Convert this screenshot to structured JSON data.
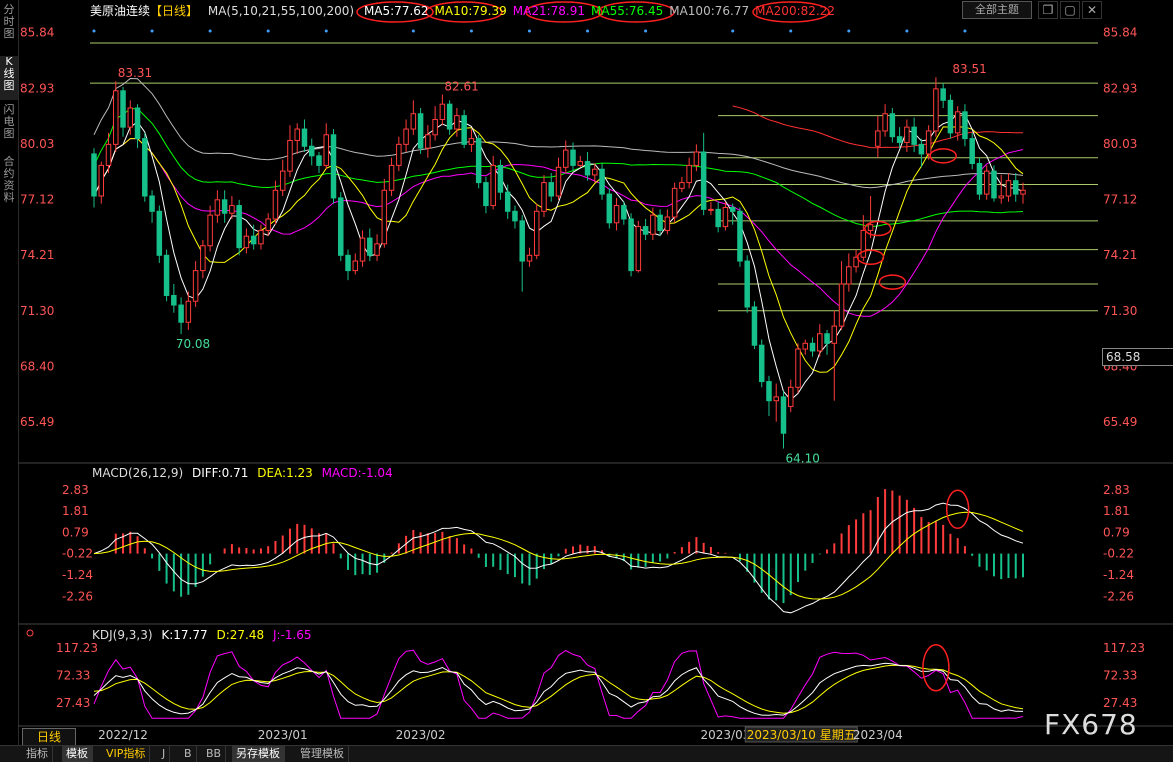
{
  "left_tabs": [
    "分时图",
    "K线图",
    "闪电图",
    "合约资料"
  ],
  "instrument": "美原油连续",
  "period_tag": "【日线】",
  "ma_header": {
    "label": "MA(5,10,21,55,100,200)",
    "items": [
      {
        "label": "MA5:77.62",
        "color": "#ffffff"
      },
      {
        "label": "MA10:79.39",
        "color": "#ffff00"
      },
      {
        "label": "MA21:78.91",
        "color": "#ff00ff"
      },
      {
        "label": "MA55:76.45",
        "color": "#00ff00"
      },
      {
        "label": "MA100:76.77",
        "color": "#bbbbbb"
      },
      {
        "label": "MA200:82.22",
        "color": "#ff3030"
      }
    ]
  },
  "top_right": {
    "theme": "全部主题",
    "icons": [
      "restore-icon",
      "minimize-icon",
      "close-icon"
    ]
  },
  "macd_header": {
    "title": "MACD(26,12,9)",
    "diff": "DIFF:0.71",
    "dea": "DEA:1.23",
    "macd": "MACD:-1.04"
  },
  "kdj_header": {
    "title": "KDJ(9,3,3)",
    "k": "K:17.77",
    "d": "D:27.48",
    "j": "J:-1.65"
  },
  "last_price": "68.58",
  "period_button": "日线",
  "bottom_tabs": [
    "指标",
    "模板",
    "VIP指标",
    "J",
    "B",
    "BB",
    "另存模板",
    "管理模板"
  ],
  "watermark": "FX678",
  "colors": {
    "up": "#ff3b3b",
    "down": "#16c08a",
    "axis": "#ff5555",
    "ma5": "#ffffff",
    "ma10": "#ffff00",
    "ma21": "#ff00ff",
    "ma55": "#00ff00",
    "ma100": "#bbbbbb",
    "ma200": "#ff3030"
  },
  "chart_data": {
    "type": "candlestick",
    "main": {
      "y_ticks": [
        "85.84",
        "82.93",
        "80.03",
        "77.12",
        "74.21",
        "71.30",
        "68.40",
        "65.49"
      ],
      "ylim": [
        63.5,
        86.5
      ],
      "annotations": [
        {
          "text": "83.31",
          "type": "high",
          "bar": 3,
          "value": 83.31
        },
        {
          "text": "82.61",
          "type": "high",
          "bar": 48,
          "value": 82.61
        },
        {
          "text": "70.08",
          "type": "low",
          "bar": 11,
          "value": 70.08
        },
        {
          "text": "64.10",
          "type": "low",
          "bar": 95,
          "value": 64.1
        },
        {
          "text": "83.51",
          "type": "high",
          "bar": 118,
          "value": 83.51
        }
      ],
      "horizontal_levels": [
        85.3,
        83.2,
        81.5,
        79.3,
        77.9,
        76.0,
        74.5,
        72.7,
        71.3
      ],
      "candles": [
        [
          79.5,
          77.3,
          79.8,
          76.7
        ],
        [
          77.3,
          78.9,
          79.1,
          76.9
        ],
        [
          78.9,
          80.0,
          80.6,
          78.5
        ],
        [
          80.0,
          82.8,
          83.3,
          79.6
        ],
        [
          82.8,
          80.9,
          83.0,
          80.4
        ],
        [
          80.9,
          81.9,
          82.3,
          80.5
        ],
        [
          81.9,
          80.3,
          82.1,
          79.8
        ],
        [
          80.3,
          77.3,
          80.6,
          77.0
        ],
        [
          77.3,
          76.5,
          77.6,
          75.9
        ],
        [
          76.5,
          74.2,
          76.8,
          73.8
        ],
        [
          74.2,
          72.1,
          74.5,
          71.8
        ],
        [
          72.1,
          71.6,
          72.7,
          71.2
        ],
        [
          71.6,
          70.7,
          72.0,
          70.08
        ],
        [
          70.7,
          71.8,
          72.3,
          70.3
        ],
        [
          71.8,
          73.4,
          73.9,
          71.5
        ],
        [
          73.4,
          74.7,
          75.0,
          73.0
        ],
        [
          74.7,
          76.3,
          76.8,
          74.4
        ],
        [
          76.3,
          77.1,
          77.6,
          75.9
        ],
        [
          77.1,
          76.4,
          77.6,
          75.9
        ],
        [
          76.4,
          76.8,
          77.3,
          76.1
        ],
        [
          76.8,
          74.6,
          77.1,
          74.2
        ],
        [
          74.6,
          75.2,
          75.6,
          74.3
        ],
        [
          75.2,
          74.8,
          75.8,
          74.5
        ],
        [
          74.8,
          75.5,
          75.8,
          74.5
        ],
        [
          75.5,
          76.1,
          76.4,
          75.2
        ],
        [
          76.1,
          77.6,
          78.1,
          75.8
        ],
        [
          77.6,
          78.6,
          79.2,
          77.3
        ],
        [
          78.6,
          80.2,
          81.0,
          78.3
        ],
        [
          80.2,
          80.8,
          81.1,
          79.5
        ],
        [
          80.8,
          79.9,
          81.3,
          79.6
        ],
        [
          79.9,
          79.4,
          80.3,
          78.9
        ],
        [
          79.4,
          78.9,
          79.6,
          78.5
        ],
        [
          78.9,
          80.5,
          81.1,
          78.7
        ],
        [
          80.5,
          77.2,
          80.8,
          76.9
        ],
        [
          77.2,
          74.2,
          77.5,
          73.9
        ],
        [
          74.2,
          73.4,
          74.5,
          72.9
        ],
        [
          73.4,
          73.9,
          74.3,
          73.2
        ],
        [
          73.9,
          75.1,
          75.5,
          73.6
        ],
        [
          75.1,
          74.2,
          75.6,
          73.9
        ],
        [
          74.2,
          74.8,
          75.3,
          73.9
        ],
        [
          74.8,
          77.6,
          78.2,
          74.6
        ],
        [
          77.6,
          78.9,
          79.3,
          77.3
        ],
        [
          78.9,
          80.0,
          80.4,
          78.6
        ],
        [
          80.0,
          80.8,
          81.3,
          79.6
        ],
        [
          80.8,
          81.6,
          82.3,
          80.5
        ],
        [
          81.6,
          79.8,
          81.9,
          79.5
        ],
        [
          79.8,
          80.5,
          81.0,
          79.3
        ],
        [
          80.5,
          81.3,
          82.0,
          80.2
        ],
        [
          81.3,
          82.1,
          82.61,
          81.0
        ],
        [
          82.1,
          80.8,
          82.3,
          80.5
        ],
        [
          80.8,
          81.5,
          81.9,
          80.4
        ],
        [
          81.5,
          80.0,
          81.8,
          79.8
        ],
        [
          80.0,
          80.3,
          80.8,
          79.6
        ],
        [
          80.3,
          78.0,
          80.5,
          77.7
        ],
        [
          78.0,
          76.8,
          78.3,
          76.4
        ],
        [
          76.8,
          78.9,
          79.4,
          76.6
        ],
        [
          78.9,
          77.5,
          79.2,
          77.1
        ],
        [
          77.5,
          76.5,
          77.9,
          76.1
        ],
        [
          76.5,
          76.0,
          76.8,
          75.6
        ],
        [
          76.0,
          73.9,
          76.3,
          72.3
        ],
        [
          73.9,
          74.2,
          74.6,
          73.6
        ],
        [
          74.2,
          76.5,
          76.9,
          74.0
        ],
        [
          76.5,
          78.0,
          78.4,
          76.2
        ],
        [
          78.0,
          77.3,
          78.5,
          77.0
        ],
        [
          77.3,
          78.8,
          79.3,
          77.1
        ],
        [
          78.8,
          79.7,
          80.2,
          78.5
        ],
        [
          79.7,
          78.9,
          80.1,
          78.6
        ],
        [
          78.9,
          79.1,
          79.4,
          78.8
        ],
        [
          79.1,
          78.4,
          79.6,
          78.1
        ],
        [
          78.4,
          78.7,
          79.0,
          78.0
        ],
        [
          78.7,
          77.4,
          79.0,
          77.1
        ],
        [
          77.4,
          75.9,
          77.7,
          75.6
        ],
        [
          75.9,
          76.8,
          77.2,
          75.5
        ],
        [
          76.8,
          76.1,
          77.0,
          75.8
        ],
        [
          76.1,
          73.4,
          76.4,
          73.1
        ],
        [
          73.4,
          75.7,
          76.0,
          73.3
        ],
        [
          75.7,
          75.3,
          76.1,
          75.0
        ],
        [
          75.3,
          76.3,
          76.7,
          75.0
        ],
        [
          76.3,
          75.5,
          76.6,
          75.2
        ],
        [
          75.5,
          76.2,
          76.6,
          75.3
        ],
        [
          76.2,
          77.7,
          78.0,
          75.9
        ],
        [
          77.7,
          78.0,
          78.3,
          77.5
        ],
        [
          78.0,
          78.9,
          79.3,
          77.7
        ],
        [
          78.9,
          79.6,
          80.0,
          78.6
        ],
        [
          79.6,
          76.6,
          80.6,
          76.3
        ],
        [
          76.6,
          76.6,
          77.0,
          76.3
        ],
        [
          76.6,
          75.7,
          77.0,
          75.4
        ],
        [
          75.7,
          76.7,
          77.0,
          75.5
        ],
        [
          76.7,
          76.5,
          76.9,
          75.8
        ],
        [
          76.5,
          73.9,
          76.7,
          73.6
        ],
        [
          73.9,
          71.5,
          74.2,
          71.2
        ],
        [
          71.5,
          69.5,
          71.8,
          69.3
        ],
        [
          69.5,
          67.6,
          69.8,
          67.3
        ],
        [
          67.6,
          66.6,
          67.9,
          65.8
        ],
        [
          66.6,
          66.8,
          67.5,
          65.5
        ],
        [
          66.8,
          64.9,
          67.1,
          64.1
        ],
        [
          66.3,
          67.3,
          67.7,
          66.0
        ],
        [
          67.3,
          69.3,
          69.6,
          67.0
        ],
        [
          69.3,
          69.6,
          69.8,
          69.0
        ],
        [
          69.6,
          69.2,
          69.9,
          68.9
        ],
        [
          69.2,
          70.1,
          70.6,
          68.9
        ],
        [
          70.1,
          69.6,
          70.3,
          69.0
        ],
        [
          69.6,
          70.5,
          71.3,
          66.6
        ],
        [
          70.5,
          72.7,
          73.9,
          70.3
        ],
        [
          72.7,
          73.6,
          74.3,
          72.3
        ],
        [
          73.6,
          74.1,
          74.5,
          73.3
        ],
        [
          74.1,
          75.5,
          76.3,
          73.9
        ],
        [
          75.5,
          75.8,
          77.3,
          75.1
        ],
        [
          79.9,
          80.7,
          81.5,
          79.3
        ],
        [
          80.7,
          81.6,
          82.1,
          80.4
        ],
        [
          81.6,
          80.4,
          81.9,
          80.1
        ],
        [
          80.4,
          80.1,
          80.9,
          79.8
        ],
        [
          80.1,
          80.9,
          81.3,
          79.6
        ],
        [
          80.9,
          80.0,
          81.4,
          79.6
        ],
        [
          80.0,
          79.5,
          80.3,
          78.8
        ],
        [
          79.5,
          80.7,
          81.0,
          79.2
        ],
        [
          80.7,
          82.9,
          83.51,
          80.4
        ],
        [
          82.9,
          82.3,
          83.2,
          81.9
        ],
        [
          82.3,
          80.6,
          82.6,
          80.3
        ],
        [
          80.6,
          81.7,
          82.0,
          80.2
        ],
        [
          81.7,
          80.3,
          82.1,
          79.9
        ],
        [
          80.3,
          79.0,
          80.6,
          78.7
        ],
        [
          79.0,
          77.4,
          79.3,
          77.1
        ],
        [
          77.4,
          78.6,
          78.9,
          77.1
        ],
        [
          78.6,
          77.2,
          78.9,
          77.0
        ],
        [
          77.2,
          77.3,
          78.4,
          76.9
        ],
        [
          77.3,
          78.1,
          78.5,
          77.0
        ],
        [
          78.1,
          77.4,
          78.5,
          77.0
        ],
        [
          77.4,
          77.6,
          78.0,
          76.9
        ]
      ]
    },
    "macd": {
      "y_ticks": [
        "2.83",
        "1.81",
        "0.79",
        "-0.22",
        "-1.24",
        "-2.26"
      ],
      "ylim": [
        -3.3,
        3.3
      ]
    },
    "kdj": {
      "y_ticks": [
        "117.23",
        "72.33",
        "27.43"
      ],
      "ylim": [
        0,
        130
      ]
    },
    "x_ticks": [
      {
        "label": "2022/12",
        "bar": 4
      },
      {
        "label": "2023/01",
        "bar": 26
      },
      {
        "label": "2023/02",
        "bar": 45
      },
      {
        "label": "2023/03",
        "bar": 87
      },
      {
        "label": "2023/03/10 星期五",
        "bar": 98
      },
      {
        "label": "2023/04",
        "bar": 108
      }
    ]
  }
}
